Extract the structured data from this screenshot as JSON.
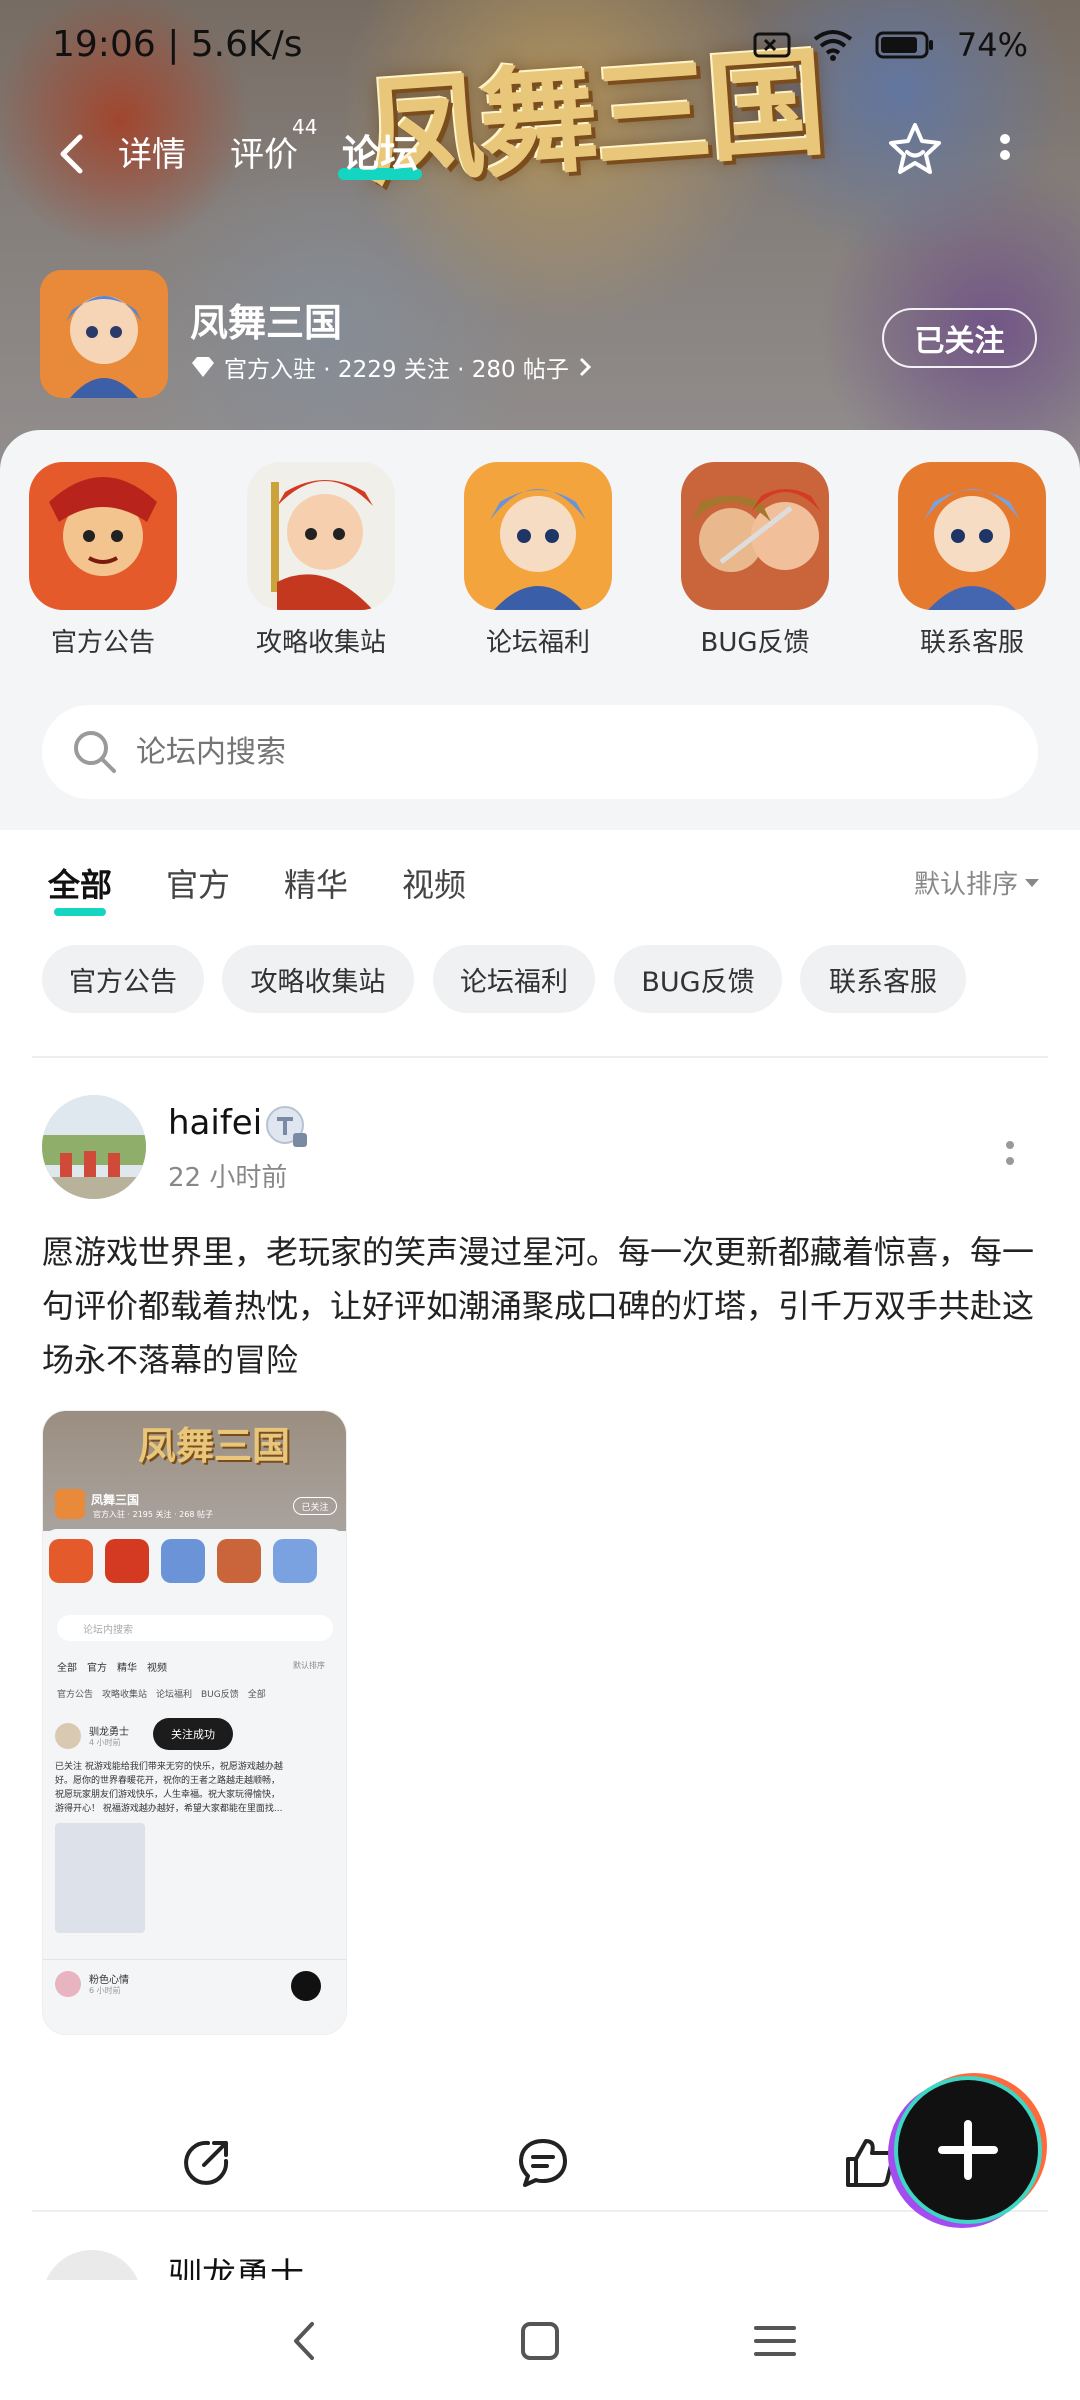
{
  "status_bar": {
    "time": "19:06 | 5.6K/s",
    "battery": "74%"
  },
  "header": {
    "logo_text": "凤舞三国",
    "tabs": [
      {
        "label": "详情"
      },
      {
        "label": "评价",
        "badge": "44"
      },
      {
        "label": "论坛",
        "active": true
      }
    ]
  },
  "game": {
    "name": "凤舞三国",
    "meta": "官方入驻 · 2229 关注 · 280 帖子",
    "follow_label": "已关注"
  },
  "quick_links": [
    {
      "label": "官方公告"
    },
    {
      "label": "攻略收集站"
    },
    {
      "label": "论坛福利"
    },
    {
      "label": "BUG反馈"
    },
    {
      "label": "联系客服"
    }
  ],
  "search": {
    "placeholder": "论坛内搜索"
  },
  "filter_tabs": [
    {
      "label": "全部",
      "active": true
    },
    {
      "label": "官方"
    },
    {
      "label": "精华"
    },
    {
      "label": "视频"
    }
  ],
  "sort_label": "默认排序",
  "chips": [
    "官方公告",
    "攻略收集站",
    "论坛福利",
    "BUG反馈",
    "联系客服"
  ],
  "post": {
    "username": "haifei",
    "time": "22 小时前",
    "content": "愿游戏世界里，老玩家的笑声漫过星河。每一次更新都藏着惊喜，每一句评价都载着热忱，让好评如潮涌聚成口碑的灯塔，引千万双手共赴这场永不落幕的冒险"
  },
  "thumb": {
    "logo": "凤舞三国",
    "name": "凤舞三国",
    "follow": "已关注",
    "meta": "官方入驻 · 2195 关注 · 268 帖子",
    "search": "论坛内搜索",
    "tabs": "全部　官方　精华　视频",
    "sort": "默认排序",
    "chips": "官方公告　攻略收集站　论坛福利　BUG反馈　全部",
    "user1": "驯龙勇士",
    "toast": "关注成功",
    "time1": "4 小时前",
    "line1": "已关注 祝游戏能给我们带来无穷的快乐，祝愿游戏越办越",
    "line2": "好。愿你的世界春暖花开，祝你的王者之路越走越顺畅，",
    "line3": "祝愿玩家朋友们游戏快乐，人生幸福。祝大家玩得愉快，",
    "line4": "游得开心！ 祝福游戏越办越好，希望大家都能在里面找...",
    "user2": "粉色心情",
    "time2": "6 小时前"
  },
  "next_post": {
    "username": "驯龙勇士"
  },
  "colors": {
    "accent": "#13d5c0",
    "text": "#1a1a1a",
    "muted": "#888888"
  }
}
